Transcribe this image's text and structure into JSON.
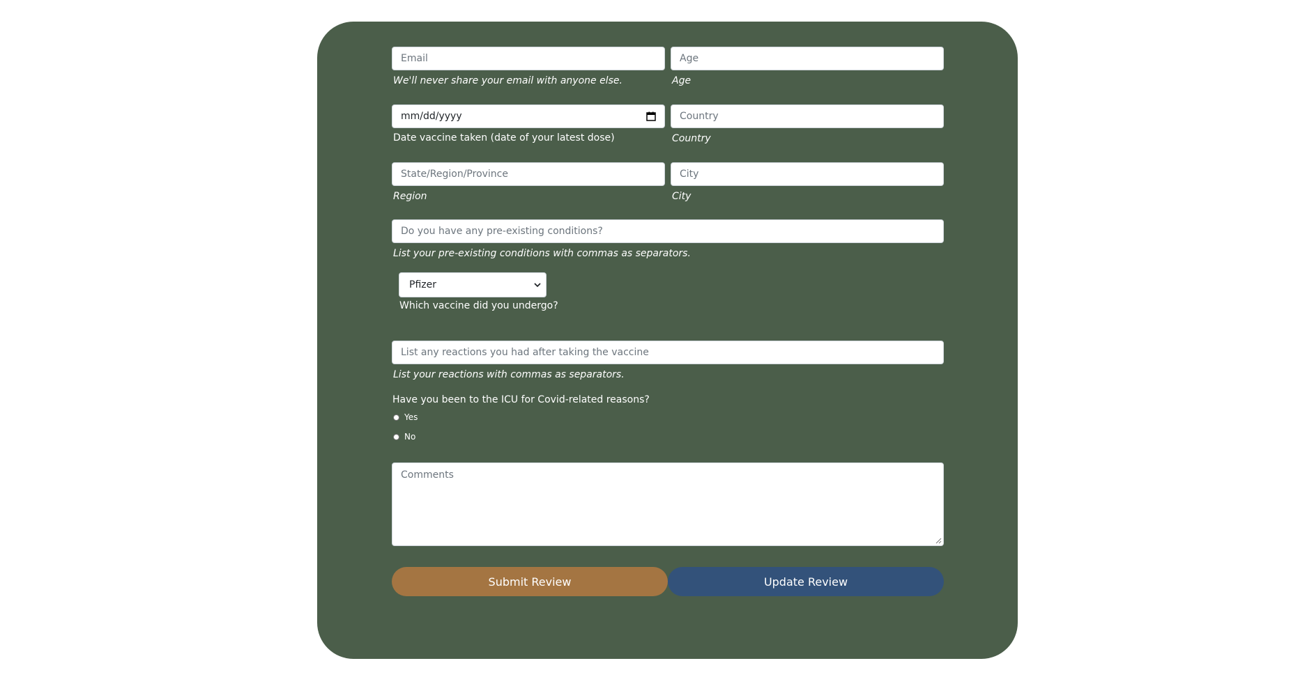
{
  "colors": {
    "card_bg": "#4b5e4a",
    "submit_bg": "#a47542",
    "update_bg": "#33527a",
    "text": "#ffffff"
  },
  "form": {
    "email": {
      "placeholder": "Email",
      "hint": "We'll never share your email with anyone else."
    },
    "age": {
      "placeholder": "Age",
      "hint": "Age"
    },
    "date": {
      "value": "mm/dd/yyyy",
      "hint": "Date vaccine taken (date of your latest dose)",
      "icon": "calendar-icon"
    },
    "country": {
      "placeholder": "Country",
      "hint": "Country"
    },
    "region": {
      "placeholder": "State/Region/Province",
      "hint": "Region"
    },
    "city": {
      "placeholder": "City",
      "hint": "City"
    },
    "conditions": {
      "placeholder": "Do you have any pre-existing conditions?",
      "hint": "List your pre-existing conditions with commas as separators."
    },
    "vaccine": {
      "selected": "Pfizer",
      "hint": "Which vaccine did you undergo?",
      "icon": "chevron-down-icon"
    },
    "reactions": {
      "placeholder": "List any reactions you had after taking the vaccine",
      "hint": "List your reactions with commas as separators."
    },
    "icu": {
      "question": "Have you been to the ICU for Covid-related reasons?",
      "options": [
        {
          "label": "Yes"
        },
        {
          "label": "No"
        }
      ]
    },
    "comments": {
      "placeholder": "Comments"
    }
  },
  "buttons": {
    "submit": "Submit Review",
    "update": "Update Review"
  }
}
